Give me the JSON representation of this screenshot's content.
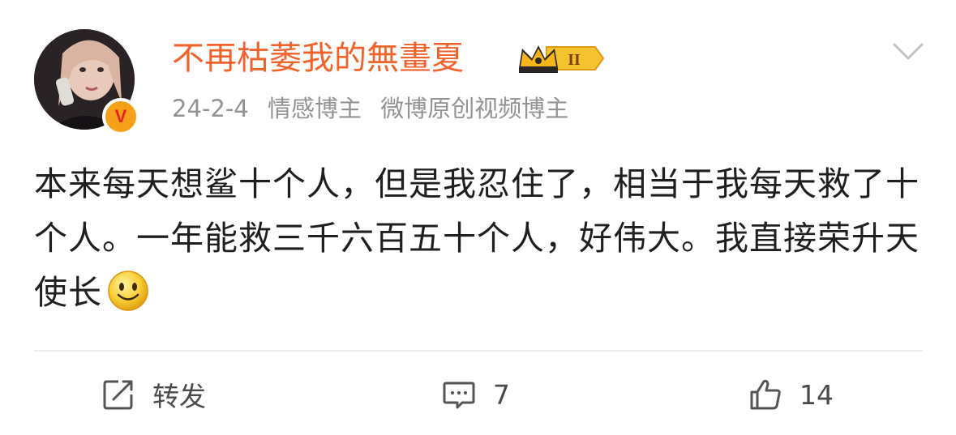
{
  "post": {
    "author": {
      "name": "不再枯萎我的無畫夏",
      "verified_mark": "V",
      "level_badge": "II"
    },
    "meta": {
      "date": "24-2-4",
      "tags": [
        "情感博主",
        "微博原创视频博主"
      ]
    },
    "content": {
      "text": "本来每天想鲨十个人，但是我忍住了，相当于我每天救了十个人。一年能救三千六百五十个人，好伟大。我直接荣升天使长",
      "emoji": "smile-emoji"
    },
    "actions": {
      "repost_label": "转发",
      "comment_count": "7",
      "like_count": "14"
    },
    "icons": [
      "avatar",
      "crown-badge-icon",
      "chevron-down-icon",
      "repost-icon",
      "comment-icon",
      "like-icon",
      "smile-emoji-icon"
    ],
    "colors": {
      "username": "#f2622b",
      "meta": "#939393",
      "text": "#1f1f1f",
      "badge_gold": "#f5b418",
      "verified_bg": "#f6a019",
      "verified_mark": "#e2231a"
    }
  }
}
